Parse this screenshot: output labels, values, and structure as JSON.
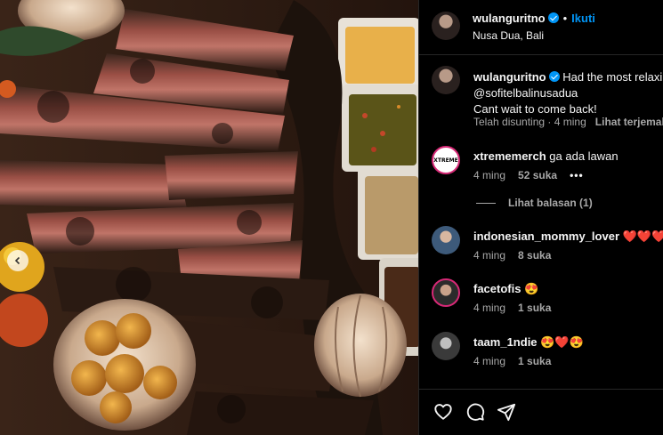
{
  "post": {
    "username": "wulanguritno",
    "follow_label": "Ikuti",
    "location": "Nusa Dua, Bali",
    "separator": "•"
  },
  "caption": {
    "username": "wulanguritno",
    "line1": "Had the most relaxing",
    "line2": "@sofitelbalinusadua",
    "line3": "Cant wait to come back!",
    "edited": "Telah disunting",
    "time": "4 ming",
    "translate": "Lihat terjemahan"
  },
  "comments": [
    {
      "username": "xtrememerch",
      "text": "ga ada lawan",
      "time": "4 ming",
      "likes": "52 suka",
      "more": "•••",
      "avatar_text": "XTREME"
    },
    {
      "username": "indonesian_mommy_lover",
      "text": "❤️❤️❤️❤️",
      "time": "4 ming",
      "likes": "8 suka"
    },
    {
      "username": "facetofis",
      "text": "😍",
      "time": "4 ming",
      "likes": "1 suka"
    },
    {
      "username": "taam_1ndie",
      "text": "😍❤️😍",
      "time": "4 ming",
      "likes": "1 suka"
    }
  ],
  "replies_label": "Lihat balasan (1)",
  "colors": {
    "accent": "#0095f6",
    "muted": "#a8a8a8",
    "background": "#000000",
    "story_ring": "#d62976"
  },
  "icons": [
    "heart-icon",
    "comment-icon",
    "share-icon",
    "verified-icon",
    "chevron-left-icon"
  ]
}
